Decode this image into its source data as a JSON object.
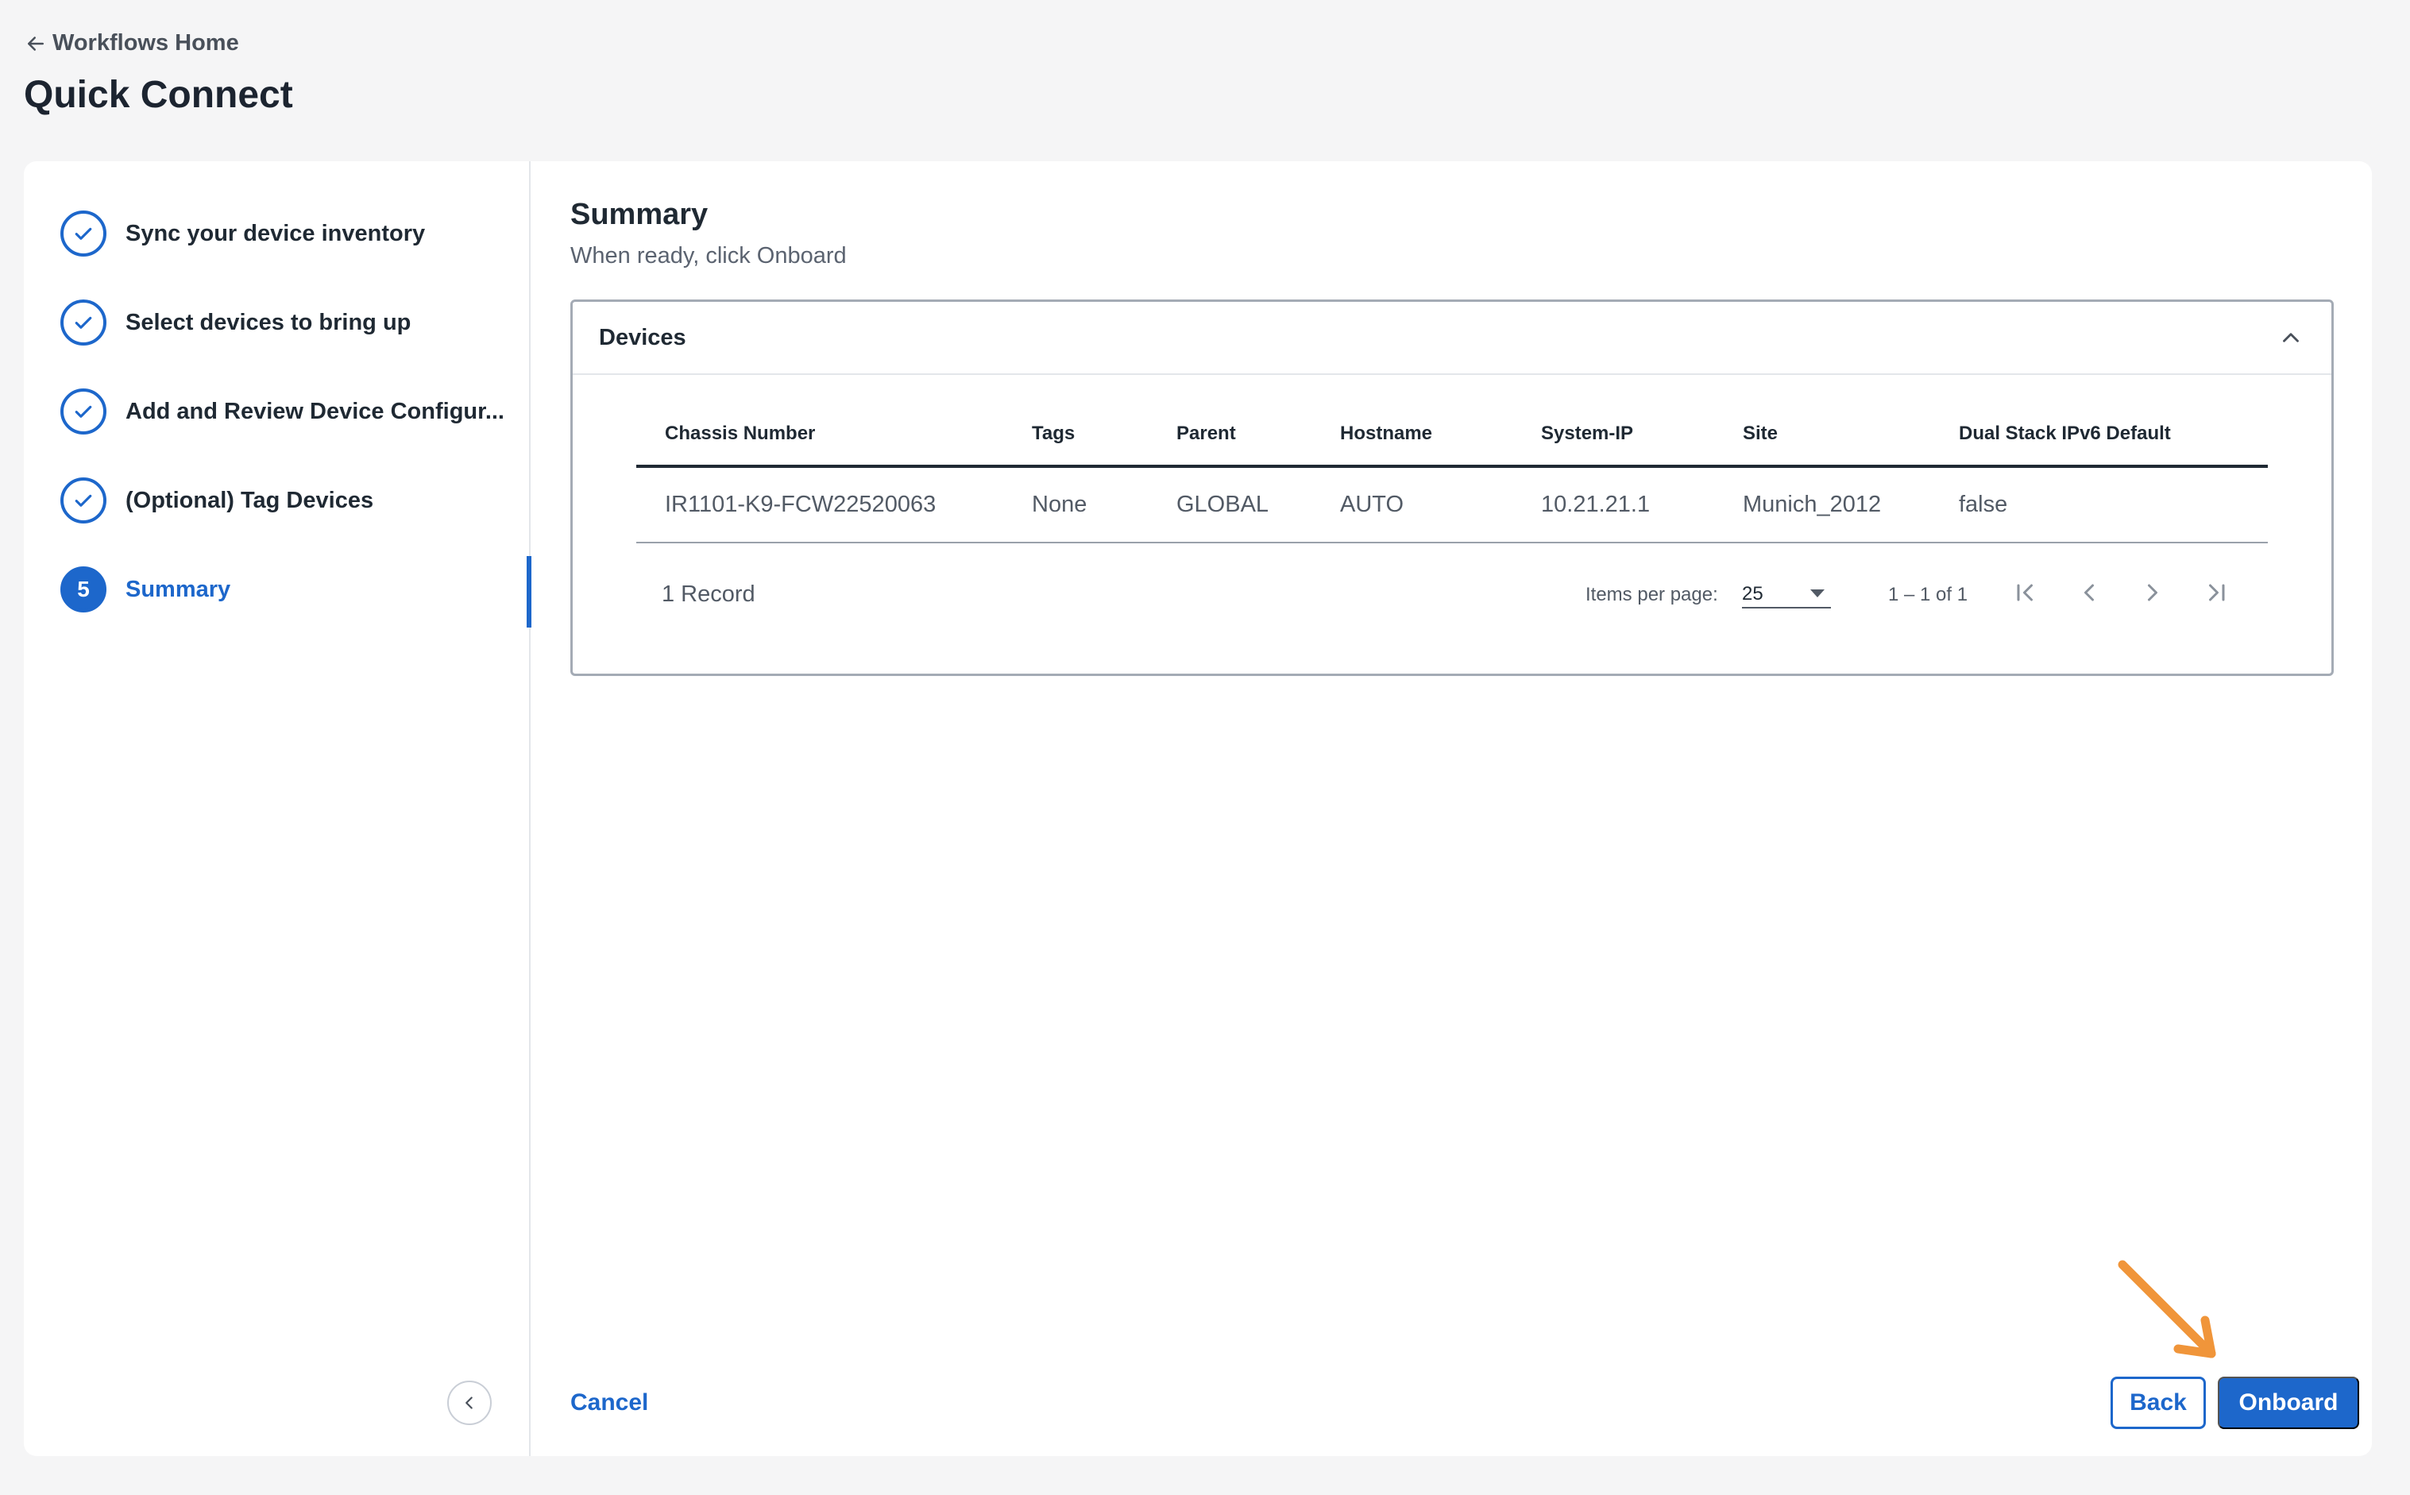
{
  "nav": {
    "back_label": "Workflows Home"
  },
  "page": {
    "title": "Quick Connect"
  },
  "steps": [
    {
      "label": "Sync your device inventory",
      "state": "done"
    },
    {
      "label": "Select devices to bring up",
      "state": "done"
    },
    {
      "label": "Add and Review Device Configur...",
      "state": "done"
    },
    {
      "label": "(Optional) Tag Devices",
      "state": "done"
    },
    {
      "label": "Summary",
      "state": "active",
      "number": "5"
    }
  ],
  "summary": {
    "title": "Summary",
    "subtitle": "When ready, click Onboard"
  },
  "devices": {
    "title": "Devices",
    "columns": [
      "Chassis Number",
      "Tags",
      "Parent",
      "Hostname",
      "System-IP",
      "Site",
      "Dual Stack IPv6 Default"
    ],
    "rows": [
      [
        "IR1101-K9-FCW22520063",
        "None",
        "GLOBAL",
        "AUTO",
        "10.21.21.1",
        "Munich_2012",
        "false"
      ]
    ],
    "record_count": "1 Record",
    "items_per_page_label": "Items per page:",
    "items_per_page": "25",
    "range": "1 – 1 of 1"
  },
  "actions": {
    "cancel": "Cancel",
    "back": "Back",
    "onboard": "Onboard"
  },
  "colors": {
    "accent": "#1d67cb",
    "annotation_arrow": "#f0953a"
  }
}
